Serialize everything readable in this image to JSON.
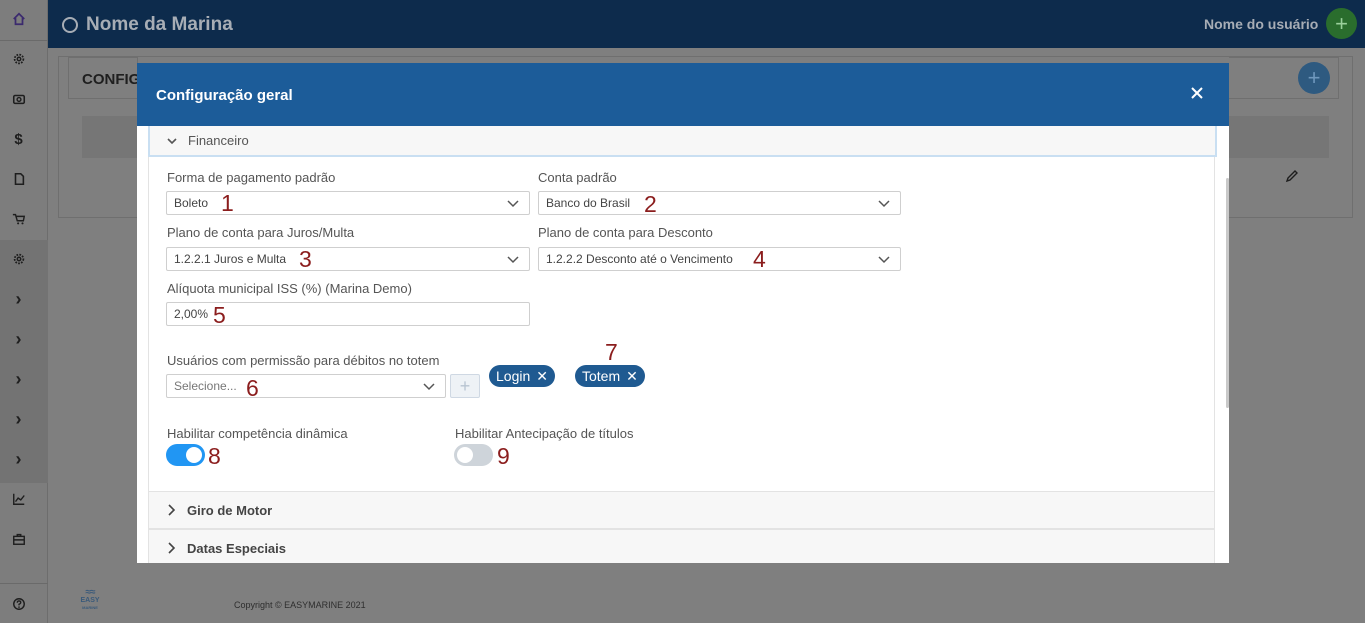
{
  "app": {
    "marina_name": "Nome da Marina",
    "user_name": "Nome do usuário",
    "user_add_glyph": "+",
    "background_panel_title": "CONFIG",
    "background_add_glyph": "+",
    "copyright": "Copyright © EASYMARINE 2021",
    "footer_logo_line1": "EASY",
    "footer_logo_line2": "MARINE"
  },
  "sidebar": {
    "items": [
      {
        "icon": "home-icon"
      },
      {
        "icon": "gear-icon"
      },
      {
        "icon": "camera-icon"
      },
      {
        "icon": "dollar-icon",
        "glyph": "$"
      },
      {
        "icon": "file-icon"
      },
      {
        "icon": "cart-icon"
      },
      {
        "icon": "gear-icon"
      },
      {
        "icon": "chevron-right-icon",
        "glyph": "›"
      },
      {
        "icon": "chevron-right-icon",
        "glyph": "›"
      },
      {
        "icon": "chevron-right-icon",
        "glyph": "›"
      },
      {
        "icon": "chevron-right-icon",
        "glyph": "›"
      },
      {
        "icon": "chevron-right-icon",
        "glyph": "›"
      },
      {
        "icon": "chart-icon"
      },
      {
        "icon": "toolbox-icon"
      },
      {
        "icon": "help-icon"
      }
    ]
  },
  "modal": {
    "title": "Configuração geral",
    "close_glyph": "✕",
    "open_section": "Financeiro",
    "fields": {
      "forma_pagamento": {
        "label": "Forma de pagamento padrão",
        "value": "Boleto",
        "marker": "1"
      },
      "conta_padrao": {
        "label": "Conta padrão",
        "value": "Banco do Brasil",
        "marker": "2"
      },
      "plano_juros": {
        "label": "Plano de conta para Juros/Multa",
        "value": "1.2.2.1 Juros e Multa",
        "marker": "3"
      },
      "plano_desconto": {
        "label": "Plano de conta para Desconto",
        "value": "1.2.2.2 Desconto até o Vencimento",
        "marker": "4"
      },
      "aliquota": {
        "label": "Alíquota municipal ISS (%) (Marina Demo)",
        "value": "2,00%",
        "marker": "5"
      },
      "usuarios": {
        "label": "Usuários com permissão para débitos no totem",
        "placeholder": "Selecione...",
        "marker": "6",
        "add_glyph": "+"
      }
    },
    "chips": {
      "marker": "7",
      "items": [
        {
          "label": "Login",
          "remove_glyph": "✕"
        },
        {
          "label": "Totem",
          "remove_glyph": "✕"
        }
      ]
    },
    "toggles": {
      "competencia": {
        "label": "Habilitar competência dinâmica",
        "checked": true,
        "marker": "8"
      },
      "antecipacao": {
        "label": "Habilitar Antecipação de títulos",
        "checked": false,
        "marker": "9"
      }
    },
    "collapsed_sections": [
      "Giro de Motor",
      "Datas Especiais"
    ]
  }
}
